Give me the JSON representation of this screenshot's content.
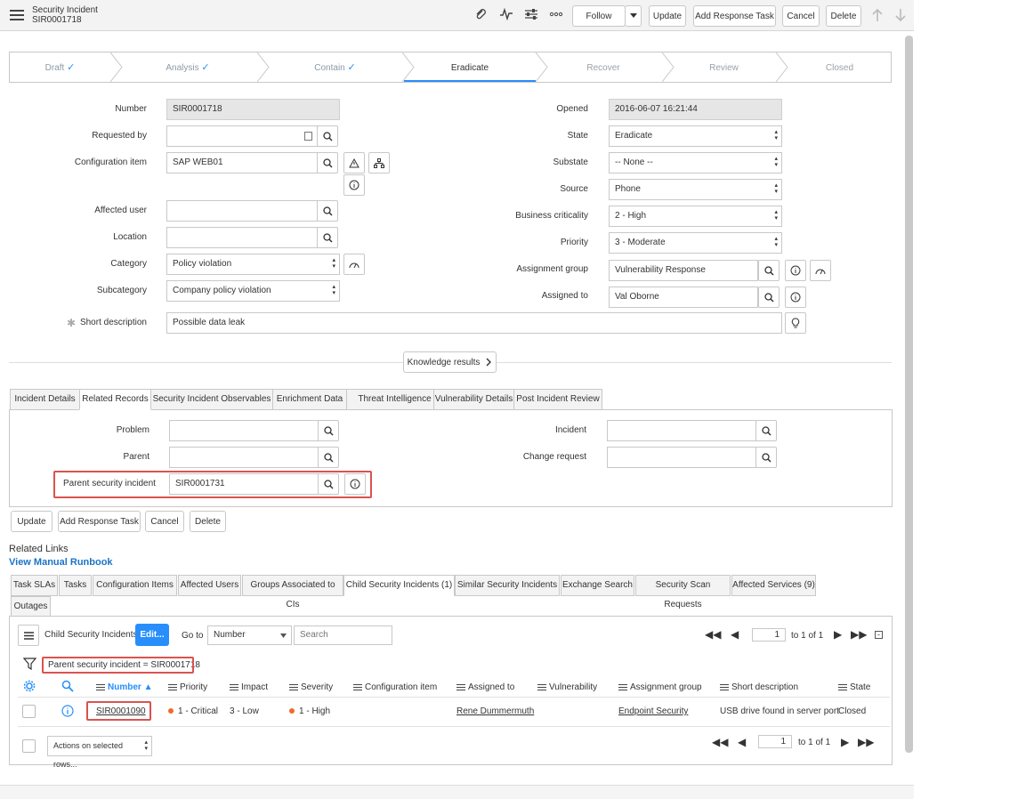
{
  "header": {
    "title": "Security Incident",
    "number": "SIR0001718",
    "buttons": {
      "follow": "Follow",
      "update": "Update",
      "add_response_task": "Add Response Task",
      "cancel": "Cancel",
      "delete": "Delete"
    }
  },
  "flow": {
    "steps": [
      {
        "label": "Draft",
        "state": "done"
      },
      {
        "label": "Analysis",
        "state": "done"
      },
      {
        "label": "Contain",
        "state": "done"
      },
      {
        "label": "Eradicate",
        "state": "active"
      },
      {
        "label": "Recover",
        "state": "pending"
      },
      {
        "label": "Review",
        "state": "pending"
      },
      {
        "label": "Closed",
        "state": "pending"
      }
    ]
  },
  "form": {
    "left": {
      "number": {
        "label": "Number",
        "value": "SIR0001718"
      },
      "requested_by": {
        "label": "Requested by",
        "value": ""
      },
      "configuration_item": {
        "label": "Configuration item",
        "value": "SAP WEB01"
      },
      "affected_user": {
        "label": "Affected user",
        "value": ""
      },
      "location": {
        "label": "Location",
        "value": ""
      },
      "category": {
        "label": "Category",
        "value": "Policy violation"
      },
      "subcategory": {
        "label": "Subcategory",
        "value": "Company policy violation"
      },
      "short_description": {
        "label": "Short description",
        "value": "Possible data leak"
      }
    },
    "right": {
      "opened": {
        "label": "Opened",
        "value": "2016-06-07 16:21:44"
      },
      "state": {
        "label": "State",
        "value": "Eradicate"
      },
      "substate": {
        "label": "Substate",
        "value": "-- None --"
      },
      "source": {
        "label": "Source",
        "value": "Phone"
      },
      "business_criticality": {
        "label": "Business criticality",
        "value": "2 - High"
      },
      "priority": {
        "label": "Priority",
        "value": "3 - Moderate"
      },
      "assignment_group": {
        "label": "Assignment group",
        "value": "Vulnerability Response"
      },
      "assigned_to": {
        "label": "Assigned to",
        "value": "Val Oborne"
      }
    },
    "knowledge_results": "Knowledge results"
  },
  "section_tabs": [
    "Incident Details",
    "Related Records",
    "Security Incident Observables",
    "Enrichment Data",
    "Threat Intelligence",
    "Vulnerability Details",
    "Post Incident Review"
  ],
  "related_records": {
    "problem": {
      "label": "Problem",
      "value": ""
    },
    "parent": {
      "label": "Parent",
      "value": ""
    },
    "parent_security_incident": {
      "label": "Parent security incident",
      "value": "SIR0001731"
    },
    "incident": {
      "label": "Incident",
      "value": ""
    },
    "change_request": {
      "label": "Change request",
      "value": ""
    }
  },
  "bottom_buttons": {
    "update": "Update",
    "add_response_task": "Add Response Task",
    "cancel": "Cancel",
    "delete": "Delete"
  },
  "related_links": {
    "heading": "Related Links",
    "runbook": "View Manual Runbook"
  },
  "related_tabs": [
    "Task SLAs",
    "Tasks",
    "Configuration Items",
    "Affected Users",
    "Groups Associated to CIs",
    "Child Security Incidents (1)",
    "Similar Security Incidents",
    "Exchange Search",
    "Security Scan Requests",
    "Affected Services (9)",
    "Outages"
  ],
  "list": {
    "title": "Child Security Incidents",
    "edit": "Edit...",
    "goto_label": "Go to",
    "goto_field": "Number",
    "search_placeholder": "Search",
    "page_value": "1",
    "page_total": "to 1 of 1",
    "filter": "Parent security incident = SIR0001718",
    "columns": [
      "Number",
      "Priority",
      "Impact",
      "Severity",
      "Configuration item",
      "Assigned to",
      "Vulnerability",
      "Assignment group",
      "Short description",
      "State"
    ],
    "rows": [
      {
        "number": "SIR0001090",
        "priority": "1 - Critical",
        "impact": "3 - Low",
        "severity": "1 - High",
        "configuration_item": "",
        "assigned_to": "Rene Dummermuth",
        "vulnerability": "",
        "assignment_group": "Endpoint Security",
        "short_description": "USB drive found in server port",
        "state": "Closed"
      }
    ],
    "actions_placeholder": "Actions on selected rows..."
  },
  "colors": {
    "accent": "#278efc",
    "highlight": "#d9534f",
    "priority_dot": "#f06a2a",
    "link": "#1a73c8"
  }
}
